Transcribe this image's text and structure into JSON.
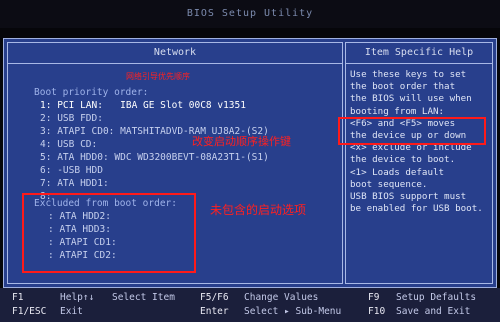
{
  "title": "BIOS Setup Utility",
  "left_header": "Network",
  "right_header": "Item Specific Help",
  "annotations": {
    "priority_note": "网络引导优先顺序",
    "change_note": "改变启动顺序操作键",
    "excluded_note": "未包含的启动选项"
  },
  "boot_priority_label": "Boot priority order:",
  "boot_order": [
    {
      "num": "1:",
      "device": "PCI LAN:",
      "detail": "IBA GE Slot 00C8 v1351"
    },
    {
      "num": "2:",
      "device": "USB FDD:",
      "detail": ""
    },
    {
      "num": "3:",
      "device": "ATAPI CD0:",
      "detail": "MATSHITADVD-RAM UJ8A2-(S2)"
    },
    {
      "num": "4:",
      "device": "USB CD:",
      "detail": ""
    },
    {
      "num": "5:",
      "device": "ATA HDD0:",
      "detail": "WDC WD3200BEVT-08A23T1-(S1)"
    },
    {
      "num": "6:",
      "device": "-USB HDD",
      "detail": ""
    },
    {
      "num": "7:",
      "device": "ATA HDD1:",
      "detail": ""
    },
    {
      "num": "8:",
      "device": "",
      "detail": ""
    }
  ],
  "excluded_label": "Excluded from boot order:",
  "excluded": [
    {
      "num": ":",
      "device": "ATA HDD2:"
    },
    {
      "num": ":",
      "device": "ATA HDD3:"
    },
    {
      "num": ":",
      "device": "ATAPI CD1:"
    },
    {
      "num": ":",
      "device": "ATAPI CD2:"
    }
  ],
  "help_lines": [
    "Use these keys to set",
    "the boot order that",
    "the BIOS will use when",
    "booting from LAN:",
    "<F6> and <F5> moves",
    "the device up or down",
    "<x> exclude or include",
    "the device to boot.",
    "<1> Loads default",
    "boot sequence.",
    "USB BIOS support must",
    "be enabled for USB boot."
  ],
  "footer": {
    "row1": [
      {
        "key": "F1",
        "label": "Help↑↓"
      },
      {
        "key": "",
        "label": "Select Item"
      },
      {
        "key": "F5/F6",
        "label": "Change Values"
      },
      {
        "key": "F9",
        "label": "Setup Defaults"
      }
    ],
    "row2": [
      {
        "key": "F1/ESC",
        "label": "Exit"
      },
      {
        "key": "",
        "label": ""
      },
      {
        "key": "Enter",
        "label": "Select ▸ Sub-Menu"
      },
      {
        "key": "F10",
        "label": "Save and Exit"
      }
    ]
  }
}
